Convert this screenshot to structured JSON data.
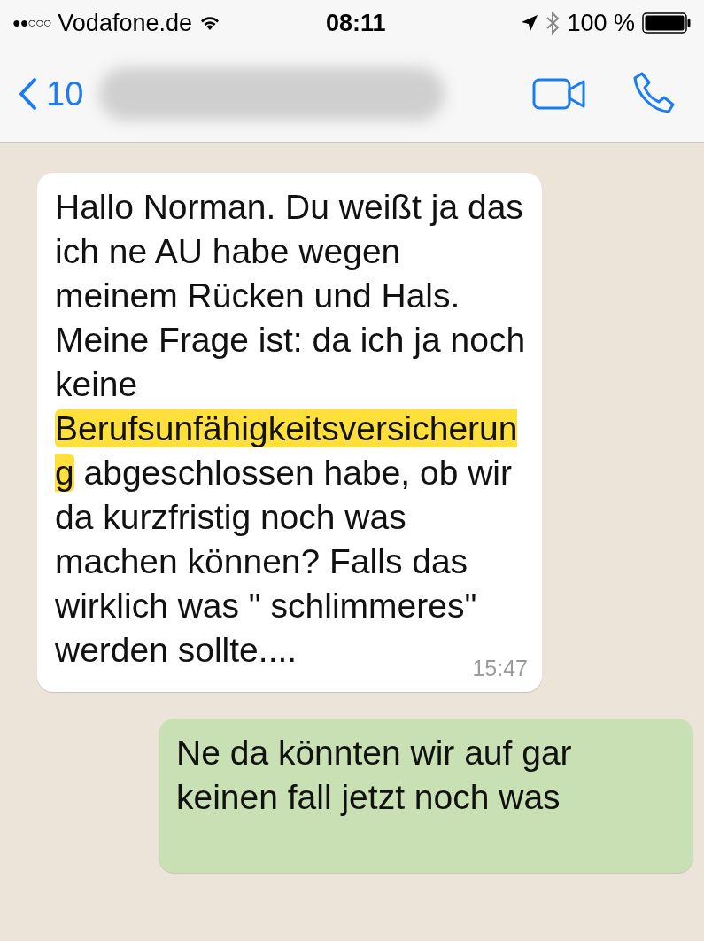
{
  "status_bar": {
    "signal_dots": "●●○○○",
    "carrier": "Vodafone.de",
    "time": "08:11",
    "battery": "100 %"
  },
  "nav_bar": {
    "back_label": "10"
  },
  "messages": [
    {
      "kind": "incoming",
      "segments": [
        {
          "text": "Hallo Norman. Du weißt ja das ich ne AU habe wegen meinem Rücken und Hals. Meine Frage ist: da ich ja noch keine ",
          "highlighted": false
        },
        {
          "text": "Berufsunfähigkeitsversicherung",
          "highlighted": true
        },
        {
          "text": " abgeschlossen habe, ob wir da kurzfristig noch was machen können? Falls das wirklich was \" schlimmeres\" werden sollte....",
          "highlighted": false
        }
      ],
      "time": "15:47"
    },
    {
      "kind": "outgoing",
      "segments": [
        {
          "text": "Ne da könnten wir auf gar keinen fall jetzt noch was",
          "highlighted": false
        }
      ]
    }
  ]
}
